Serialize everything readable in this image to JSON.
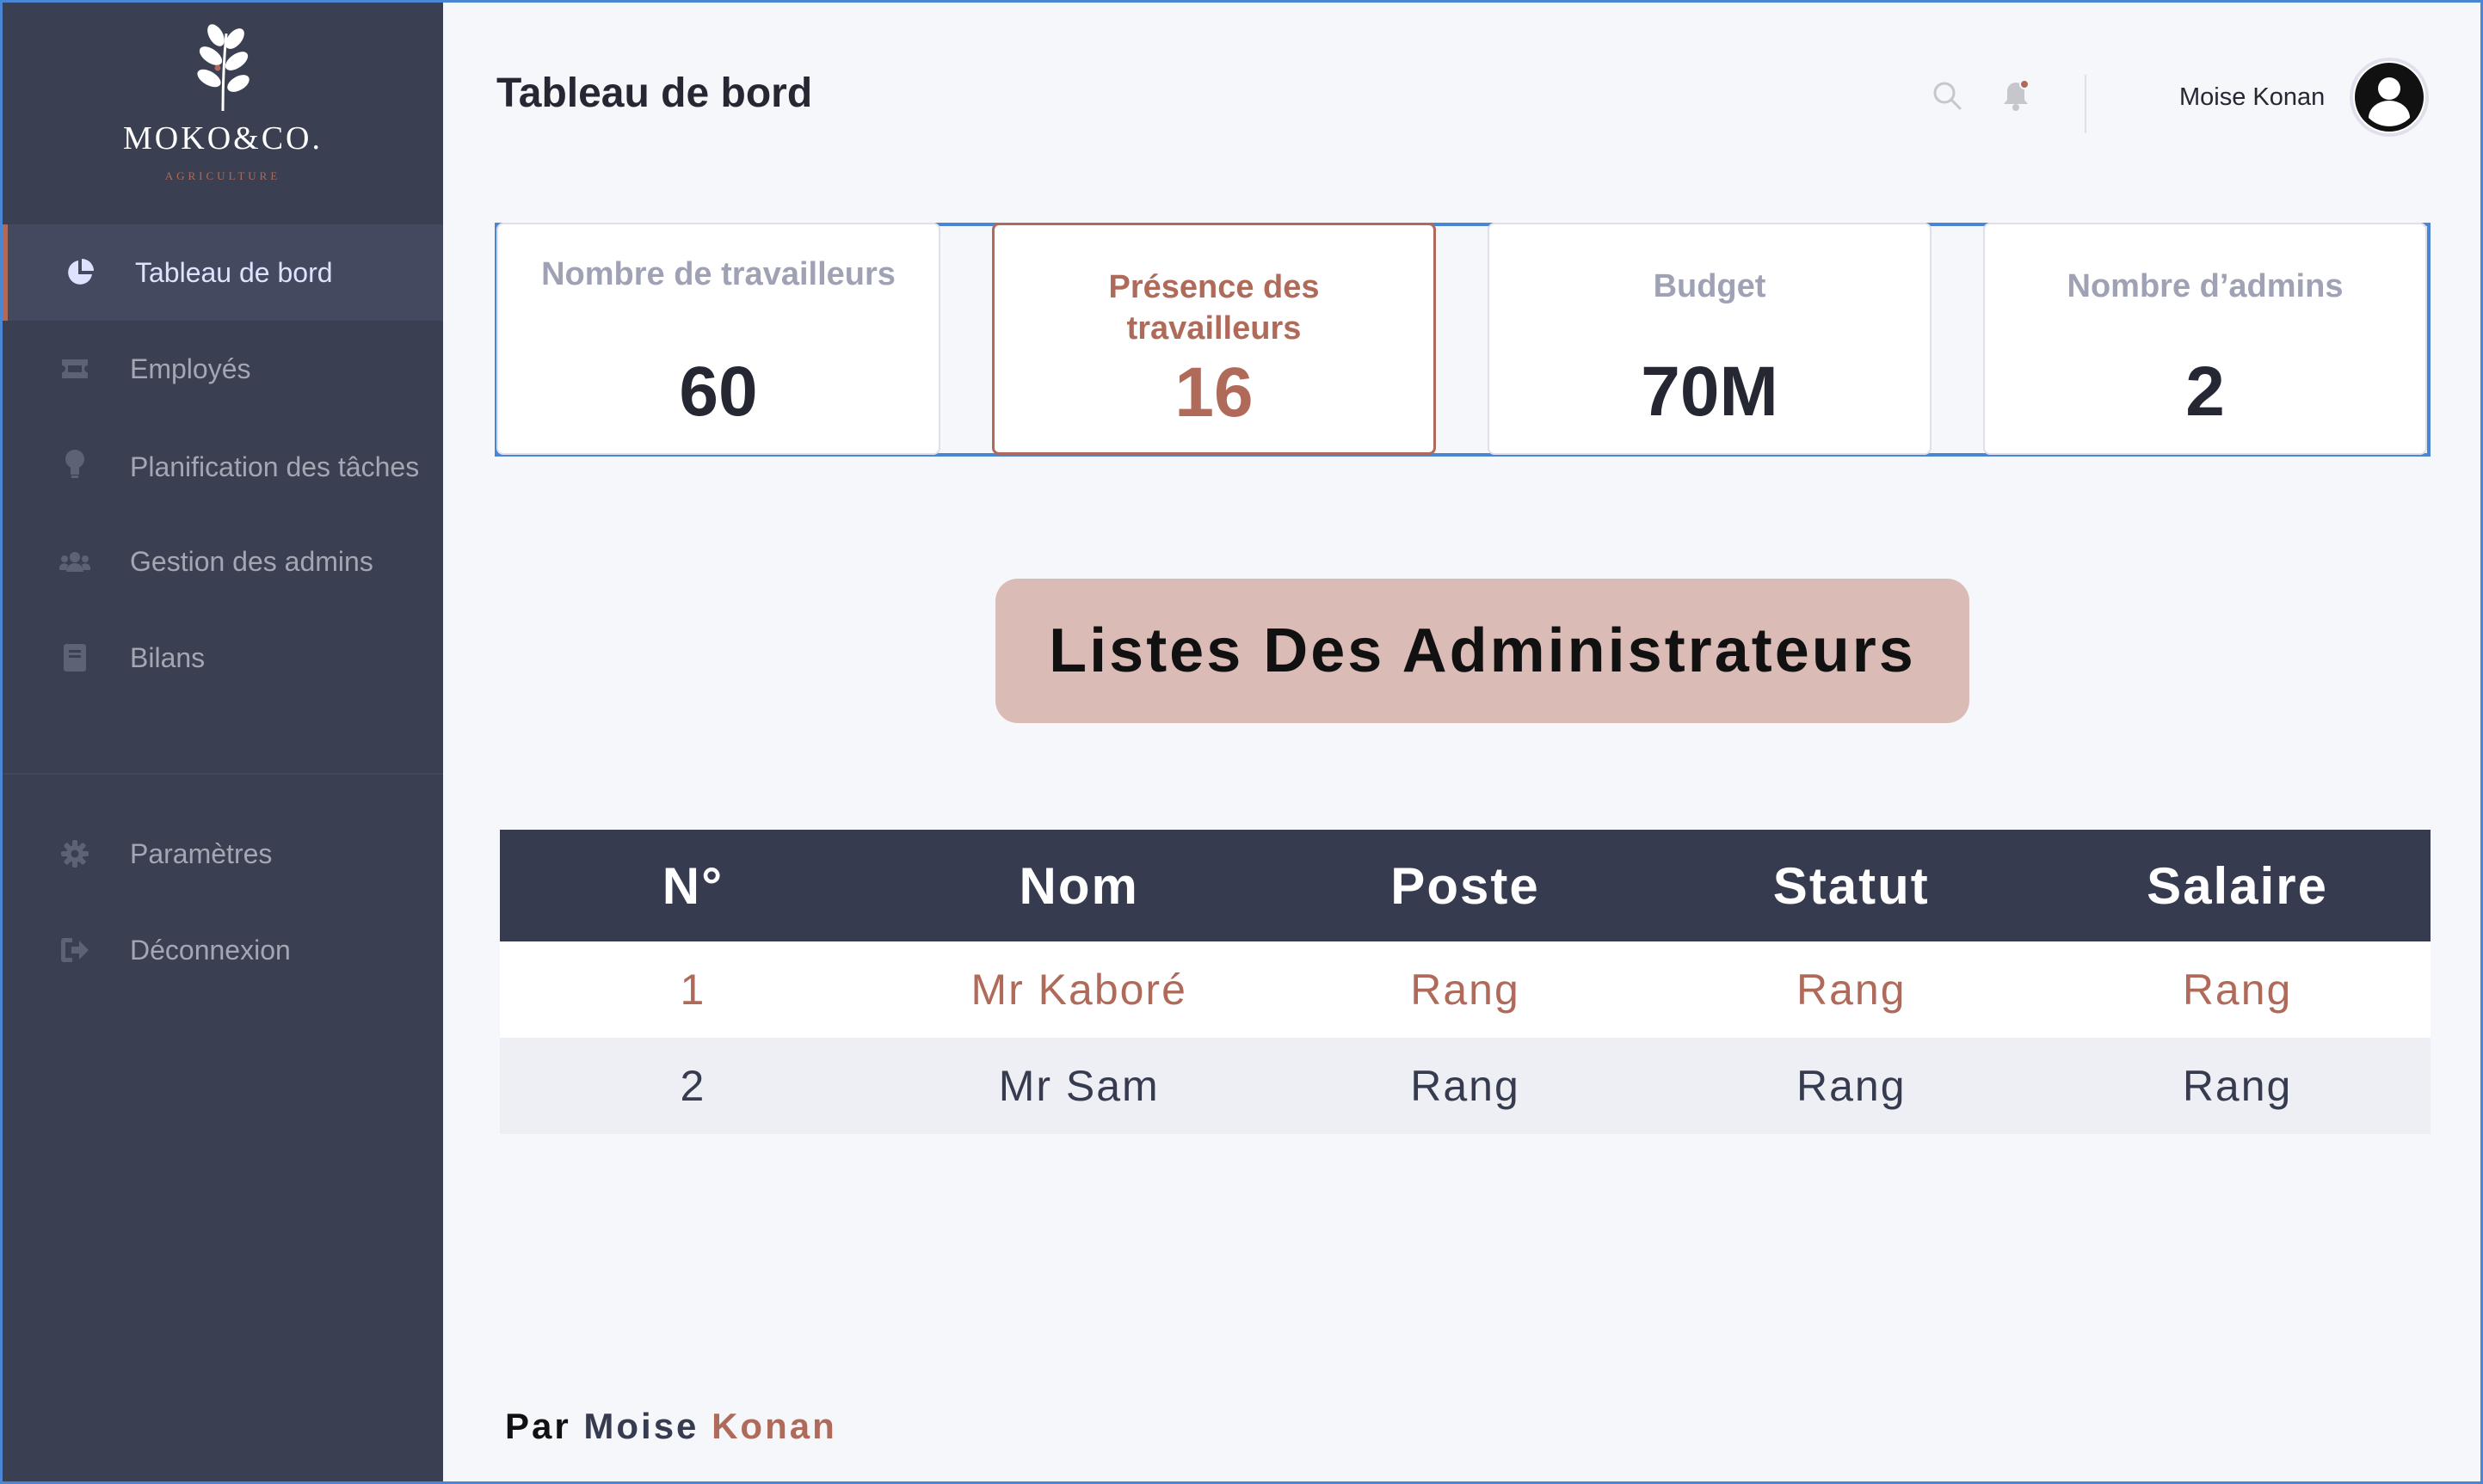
{
  "brand": {
    "name": "MOKO&CO.",
    "tagline": "AGRICULTURE"
  },
  "sidebar": {
    "items": [
      {
        "label": "Tableau de bord",
        "icon": "pie-chart-icon",
        "active": true
      },
      {
        "label": "Employés",
        "icon": "ticket-icon"
      },
      {
        "label": "Planification des tâches",
        "icon": "lightbulb-icon"
      },
      {
        "label": "Gestion des admins",
        "icon": "users-icon"
      },
      {
        "label": "Bilans",
        "icon": "book-icon"
      }
    ],
    "bottom_items": [
      {
        "label": "Paramètres",
        "icon": "gear-icon"
      },
      {
        "label": "Déconnexion",
        "icon": "logout-icon"
      }
    ]
  },
  "header": {
    "title": "Tableau de bord",
    "user_name": "Moise Konan",
    "icons": [
      "search-icon",
      "bell-icon",
      "avatar-icon"
    ]
  },
  "stats": [
    {
      "label": "Nombre de travailleurs",
      "value": "60"
    },
    {
      "label": "Présence des travailleurs",
      "value": "16",
      "highlight": true
    },
    {
      "label": "Budget",
      "value": "70M"
    },
    {
      "label": "Nombre d’admins",
      "value": "2"
    }
  ],
  "section": {
    "title": "Listes Des Administrateurs"
  },
  "table": {
    "columns": [
      "N°",
      "Nom",
      "Poste",
      "Statut",
      "Salaire"
    ],
    "rows": [
      [
        "1",
        "Mr Kaboré",
        "Rang",
        "Rang",
        "Rang"
      ],
      [
        "2",
        "Mr Sam",
        "Rang",
        "Rang",
        "Rang"
      ]
    ]
  },
  "footer": {
    "prefix": "Par",
    "first_name": "Moise",
    "last_name": "Konan"
  },
  "colors": {
    "sidebar_bg": "#3a3f51",
    "accent": "#b06a5a",
    "frame_border": "#4a86d4",
    "table_header_bg": "#363b50",
    "section_title_bg": "#dbbbb6"
  }
}
